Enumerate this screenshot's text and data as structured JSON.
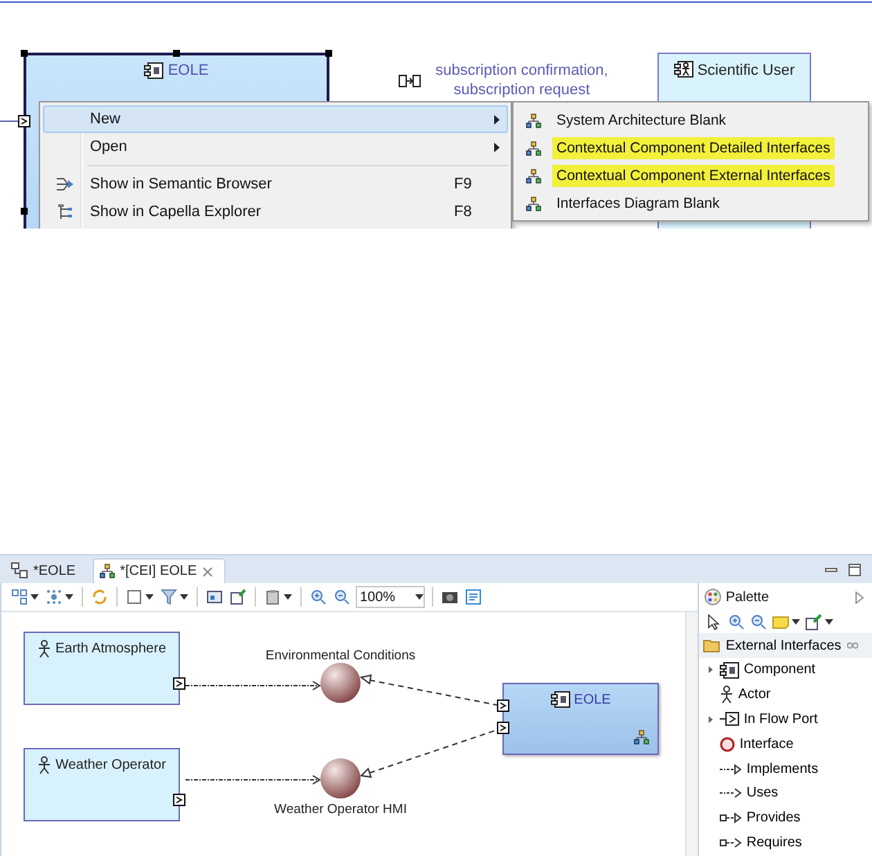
{
  "top": {
    "nodes": [
      {
        "kind": "component",
        "label": "EOLE",
        "selected": true
      },
      {
        "kind": "actor",
        "label": "Scientific User",
        "selected": false
      }
    ],
    "exchange_label": "subscription confirmation, subscription request",
    "context_menu": {
      "items": [
        {
          "kind": "plain",
          "label": "New",
          "submenu": true,
          "selected": true
        },
        {
          "kind": "plain",
          "label": "Open",
          "submenu": true,
          "selected": false
        },
        {
          "kind": "separator"
        },
        {
          "kind": "browser",
          "label": "Show in Semantic Browser",
          "shortcut": "F9",
          "submenu": false,
          "selected": false
        },
        {
          "kind": "explorer",
          "label": "Show in Capella Explorer",
          "shortcut": "F8",
          "submenu": false,
          "selected": false
        }
      ]
    },
    "submenu": {
      "items": [
        {
          "label": "System Architecture Blank",
          "highlighted": false
        },
        {
          "label": "Contextual Component Detailed Interfaces",
          "highlighted": true
        },
        {
          "label": "Contextual Component External Interfaces",
          "highlighted": true
        },
        {
          "label": "Interfaces Diagram Blank",
          "highlighted": false
        }
      ]
    }
  },
  "bottom": {
    "tabs": [
      {
        "kind": "architecture",
        "label": "*EOLE",
        "selected": false
      },
      {
        "kind": "interfaces",
        "label": "*[CEI] EOLE",
        "selected": true
      }
    ],
    "toolbar": {
      "zoom": "100%"
    },
    "diagram": {
      "nodes": [
        {
          "kind": "actor",
          "label": "Earth Atmosphere"
        },
        {
          "kind": "actor",
          "label": "Weather Operator"
        },
        {
          "kind": "interface",
          "label": "Environmental Conditions"
        },
        {
          "kind": "interface",
          "label": "Weather Operator HMI"
        },
        {
          "kind": "component",
          "label": "EOLE"
        }
      ]
    },
    "palette": {
      "title": "Palette",
      "drawer": "External Interfaces",
      "items": [
        {
          "kind": "component",
          "label": "Component",
          "expandable": true
        },
        {
          "kind": "actor",
          "label": "Actor",
          "expandable": false
        },
        {
          "kind": "port",
          "label": "In Flow Port",
          "expandable": true
        },
        {
          "kind": "interface",
          "label": "Interface",
          "expandable": false
        },
        {
          "kind": "implements",
          "label": "Implements",
          "expandable": false
        },
        {
          "kind": "uses",
          "label": "Uses",
          "expandable": false
        },
        {
          "kind": "provides",
          "label": "Provides",
          "expandable": false
        },
        {
          "kind": "requires",
          "label": "Requires",
          "expandable": false
        }
      ]
    }
  }
}
